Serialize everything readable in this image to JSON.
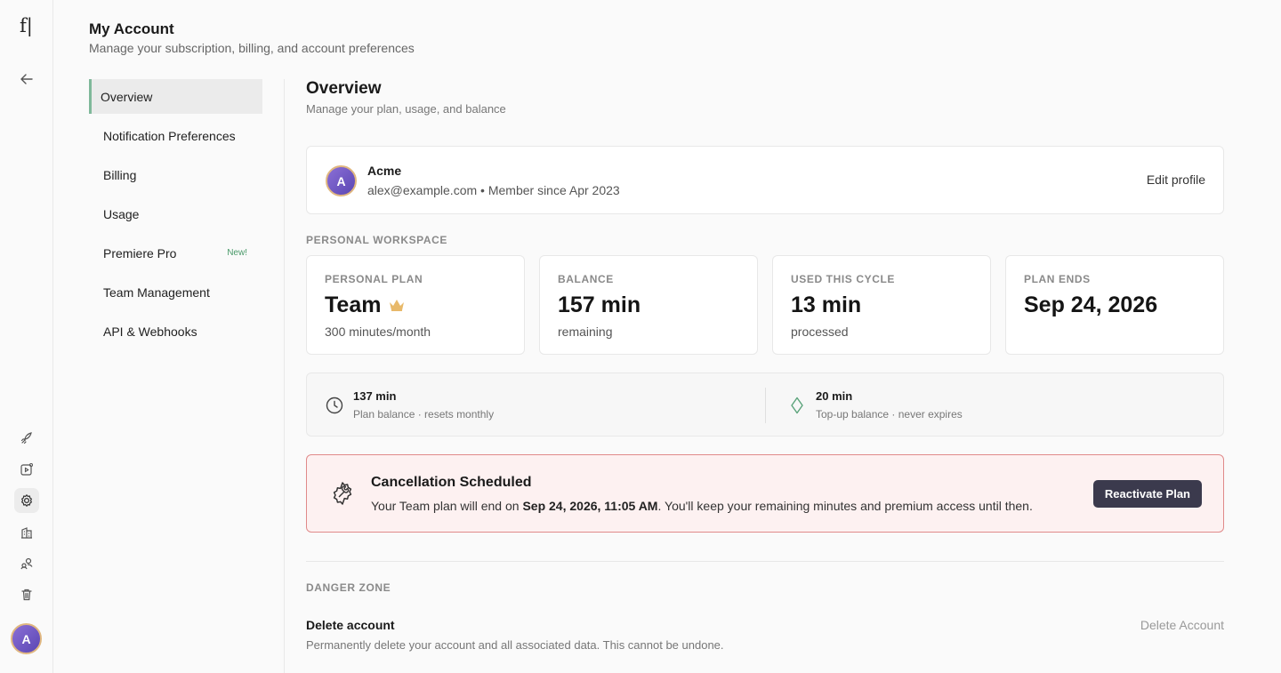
{
  "header": {
    "title": "My Account",
    "subtitle": "Manage your subscription, billing, and account preferences"
  },
  "rail": {
    "logo": "f|",
    "icons": [
      "back-arrow-icon",
      "rocket-icon",
      "video-icon",
      "settings-icon",
      "building-icon",
      "users-icon",
      "trash-icon"
    ],
    "avatar_initial": "A"
  },
  "nav": {
    "items": [
      {
        "label": "Overview",
        "active": true
      },
      {
        "label": "Notification Preferences"
      },
      {
        "label": "Billing"
      },
      {
        "label": "Usage"
      },
      {
        "label": "Premiere Pro",
        "badge": "New!"
      },
      {
        "label": "Team Management"
      },
      {
        "label": "API & Webhooks"
      }
    ]
  },
  "overview": {
    "title": "Overview",
    "subtitle": "Manage your plan, usage, and balance"
  },
  "profile": {
    "initial": "A",
    "name": "Acme",
    "meta": "alex@example.com • Member since Apr 2023",
    "edit_label": "Edit profile"
  },
  "workspace": {
    "label": "PERSONAL WORKSPACE",
    "stats": [
      {
        "label": "PERSONAL PLAN",
        "value": "Team",
        "desc": "300 minutes/month",
        "icon": "crown-icon"
      },
      {
        "label": "BALANCE",
        "value": "157 min",
        "desc": "remaining"
      },
      {
        "label": "USED THIS CYCLE",
        "value": "13 min",
        "desc": "processed"
      },
      {
        "label": "PLAN ENDS",
        "value": "Sep 24, 2026",
        "desc": ""
      }
    ]
  },
  "balances": [
    {
      "value": "137 min",
      "desc": "Plan balance · resets monthly",
      "icon": "clock-icon"
    },
    {
      "value": "20 min",
      "desc": "Top-up balance · never expires",
      "icon": "diamond-icon"
    }
  ],
  "cancellation": {
    "title": "Cancellation Scheduled",
    "msg_prefix": "Your Team plan will end on ",
    "msg_date": "Sep 24, 2026, 11:05 AM",
    "msg_suffix": ". You'll keep your remaining minutes and premium access until then.",
    "button": "Reactivate Plan",
    "colors": {
      "border": "#e08a8a",
      "background": "#fdf1f1"
    }
  },
  "danger": {
    "label": "DANGER ZONE",
    "title": "Delete account",
    "desc": "Permanently delete your account and all associated data. This cannot be undone.",
    "button": "Delete Account"
  }
}
